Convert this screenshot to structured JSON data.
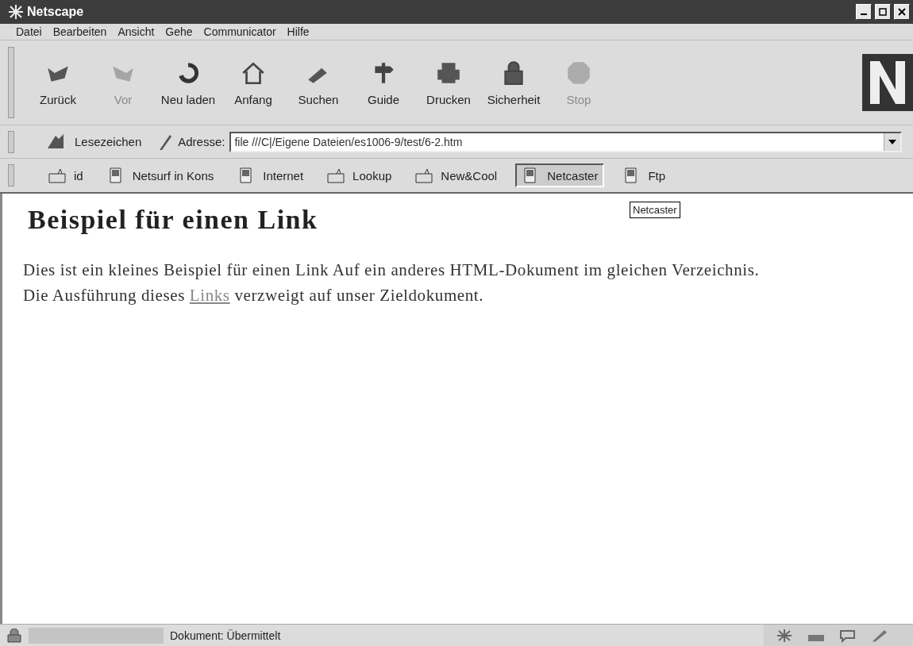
{
  "window": {
    "title": "Netscape"
  },
  "menu": [
    "Datei",
    "Bearbeiten",
    "Ansicht",
    "Gehe",
    "Communicator",
    "Hilfe"
  ],
  "toolbar": [
    {
      "label": "Zurück",
      "disabled": false
    },
    {
      "label": "Vor",
      "disabled": true
    },
    {
      "label": "Neu laden",
      "disabled": false
    },
    {
      "label": "Anfang",
      "disabled": false
    },
    {
      "label": "Suchen",
      "disabled": false
    },
    {
      "label": "Guide",
      "disabled": false
    },
    {
      "label": "Drucken",
      "disabled": false
    },
    {
      "label": "Sicherheit",
      "disabled": false
    },
    {
      "label": "Stop",
      "disabled": true
    }
  ],
  "location_bar": {
    "bookmarks_label": "Lesezeichen",
    "address_label": "Adresse:",
    "address": "file ///C|/Eigene Dateien/es1006-9/test/6-2.htm"
  },
  "personal_toolbar": [
    {
      "label": "id",
      "kind": "folder",
      "pressed": false
    },
    {
      "label": "Netsurf in Kons",
      "kind": "page",
      "pressed": false
    },
    {
      "label": "Internet",
      "kind": "page",
      "pressed": false
    },
    {
      "label": "Lookup",
      "kind": "folder",
      "pressed": false
    },
    {
      "label": "New&Cool",
      "kind": "folder",
      "pressed": false
    },
    {
      "label": "Netcaster",
      "kind": "page",
      "pressed": true
    },
    {
      "label": "Ftp",
      "kind": "page",
      "pressed": false
    }
  ],
  "tooltip": "Netcaster",
  "page": {
    "heading": "Beispiel für einen Link",
    "paragraph_before": "Dies ist ein kleines Beispiel für einen Link Auf ein anderes HTML-Dokument im gleichen Verzeichnis. Die Ausführung dieses",
    "link": "Links",
    "paragraph_after": "verzweigt auf unser Zieldokument."
  },
  "status_bar": {
    "text": "Dokument: Übermittelt"
  }
}
